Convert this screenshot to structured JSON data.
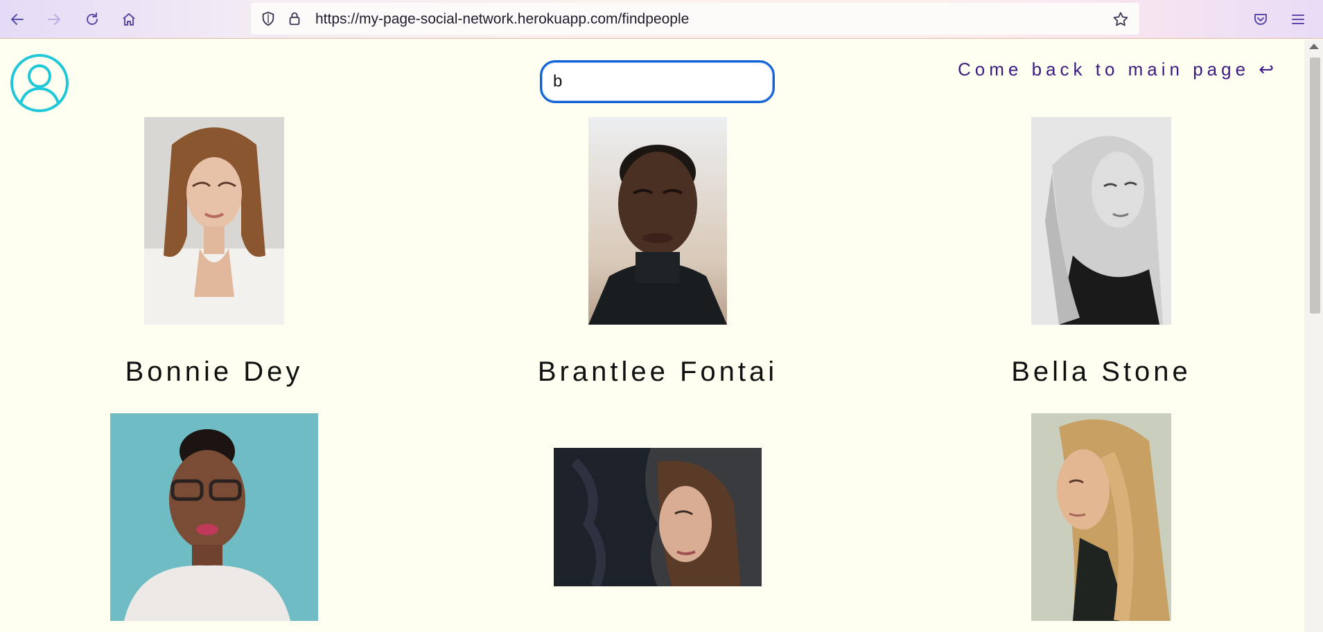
{
  "browser": {
    "url": "https://my-page-social-network.herokuapp.com/findpeople"
  },
  "page": {
    "search": {
      "value": "b"
    },
    "back_link": "Come back to main page ↩",
    "people": [
      {
        "name": "Bonnie Dey"
      },
      {
        "name": "Brantlee Fontai"
      },
      {
        "name": "Bella Stone"
      },
      {
        "name": ""
      },
      {
        "name": ""
      },
      {
        "name": ""
      }
    ]
  },
  "colors": {
    "page_bg": "#fefff1",
    "link": "#3c1a84",
    "search_border": "#0f62d6",
    "logo": "#1fc8d8"
  }
}
